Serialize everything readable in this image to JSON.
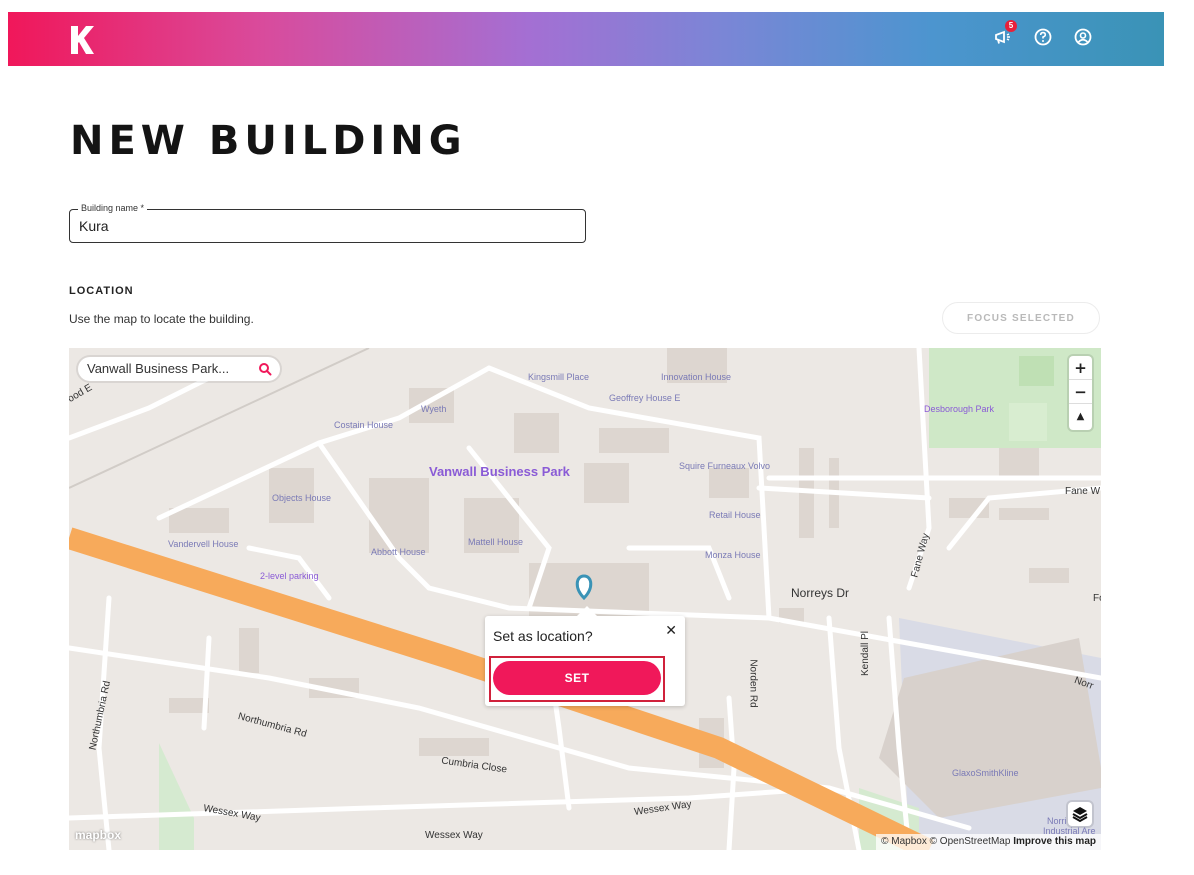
{
  "header": {
    "notification_count": "5",
    "icons": [
      "announcement-icon",
      "help-icon",
      "account-icon"
    ]
  },
  "page": {
    "title": "NEW BUILDING"
  },
  "form": {
    "building_name_label": "Building name *",
    "building_name_value": "Kura"
  },
  "location": {
    "title": "LOCATION",
    "subtitle": "Use the map to locate the building.",
    "focus_selected_label": "FOCUS SELECTED"
  },
  "map": {
    "search_value": "Vanwall Business Park...",
    "zoom_in": "+",
    "zoom_out": "−",
    "compass": "▲",
    "mapbox_logo": "mapbox",
    "attribution_mapbox": "© Mapbox",
    "attribution_osm": "© OpenStreetMap",
    "attribution_improve": "Improve this map",
    "labels": {
      "kingsmill_place": "Kingsmill Place",
      "innovation_house": "Innovation House",
      "geoffrey_house": "Geoffrey House E",
      "wyeth": "Wyeth",
      "costain_house": "Costain House",
      "vanwall_business_park": "Vanwall Business Park",
      "squire_furneaux": "Squire Furneaux Volvo",
      "desborough_park": "Desborough Park",
      "retail_house": "Retail House",
      "objects_house": "Objects House",
      "vandervell_house": "Vandervell House",
      "abbott_house": "Abbott House",
      "mattell_house": "Mattell House",
      "monza_house": "Monza House",
      "two_level_parking": "2-level parking",
      "norreys_dr": "Norreys Dr",
      "fane_way": "Fane Way",
      "fane_w": "Fane W",
      "kendall_pl": "Kendall Pl",
      "norden_rd": "Norden Rd",
      "norr": "Norr",
      "northumbria_rd": "Northumbria Rd",
      "northumbria_rd_2": "Northumbria Rd",
      "cumbria_close": "Cumbria Close",
      "wessex_way": "Wessex Way",
      "wessex_way_2": "Wessex Way",
      "wessex_way_3": "Wessex Way",
      "glaxosmithkline": "GlaxoSmithKline",
      "norris_industrial": "Norri    ve",
      "industrial_are": "Industrial Are",
      "od_e": "ood E",
      "fo": "Fo"
    },
    "popup": {
      "text": "Set as location?",
      "close": "✕",
      "set_label": "SET"
    }
  },
  "colors": {
    "accent": "#f0185a",
    "highlight_outline": "#d0213b",
    "motorway": "#f7aa5b"
  }
}
